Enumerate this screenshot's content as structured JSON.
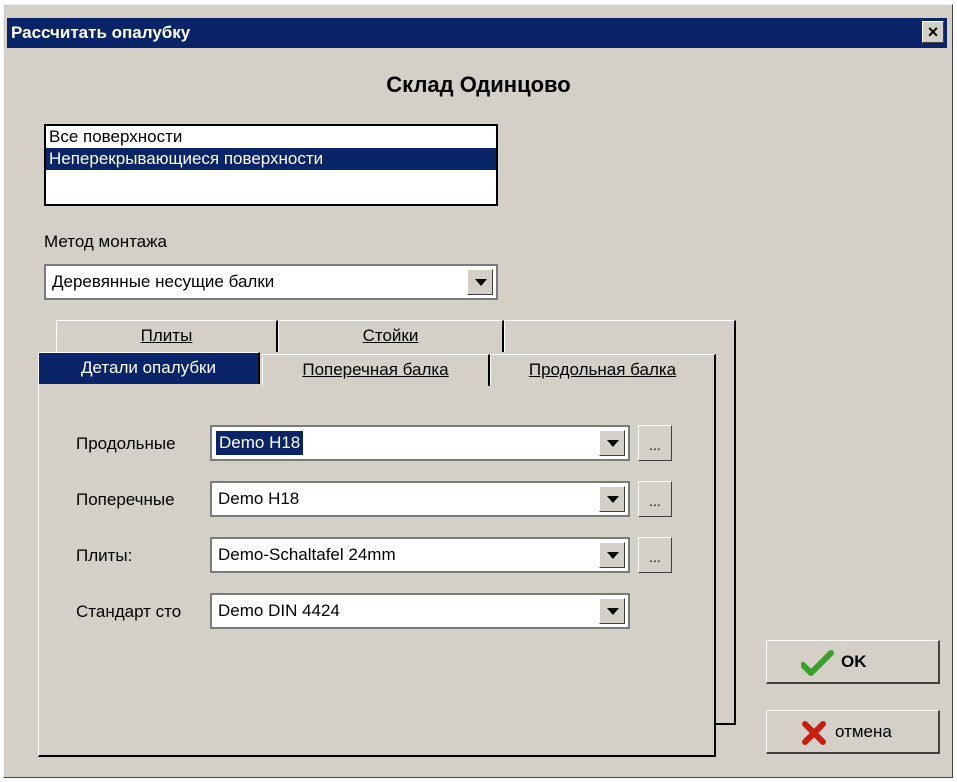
{
  "window": {
    "title": "Рассчитать опалубку",
    "close_glyph": "×"
  },
  "heading": "Склад Одинцово",
  "surfaces": {
    "items": [
      "Все поверхности",
      "Неперекрывающиеся поверхности"
    ],
    "selected_index": 1
  },
  "method": {
    "label": "Метод монтажа",
    "value": "Деревянные несущие балки"
  },
  "tabs_back": [
    "Плиты",
    "Стойки"
  ],
  "tabs_front": [
    "Детали опалубки",
    "Поперечная балка",
    "Продольная балка"
  ],
  "active_tab": "Детали опалубки",
  "fields": [
    {
      "label": "Продольные",
      "value": "Demo H18",
      "has_browse": true,
      "focused": true
    },
    {
      "label": "Поперечные",
      "value": "Demo H18",
      "has_browse": true,
      "focused": false
    },
    {
      "label": "Плиты:",
      "value": "Demo-Schaltafel 24mm",
      "has_browse": true,
      "focused": false
    },
    {
      "label": "Стандарт сто",
      "value": "Demo DIN 4424",
      "has_browse": false,
      "focused": false
    }
  ],
  "browse_label": "...",
  "buttons": {
    "ok": "OK",
    "cancel": "отмена"
  },
  "colors": {
    "title_bg": "#0a246a",
    "face": "#d4d0c8",
    "ok_check": "#3aa02a",
    "cancel_x": "#c81e10"
  },
  "icons": {
    "ok": "check-icon",
    "cancel": "x-icon",
    "dropdown": "chevron-down-icon"
  }
}
